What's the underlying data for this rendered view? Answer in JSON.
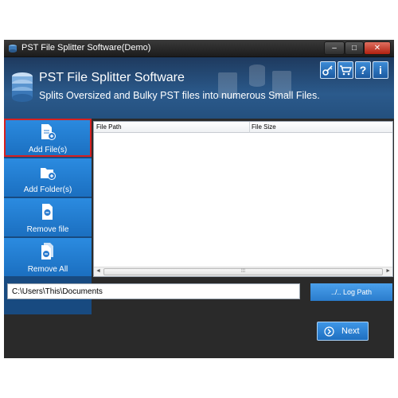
{
  "window": {
    "title": "PST File Splitter Software(Demo)"
  },
  "titlebar": {
    "minimize": "–",
    "maximize": "□",
    "close": "✕"
  },
  "header": {
    "app_name": "PST File Splitter Software",
    "tagline": "Splits Oversized and Bulky PST files into numerous Small Files.",
    "buttons": [
      {
        "icon": "key-icon",
        "symbol": "🔑"
      },
      {
        "icon": "cart-icon",
        "symbol": "🛒"
      },
      {
        "icon": "help-icon",
        "symbol": "?"
      },
      {
        "icon": "info-icon",
        "symbol": "i"
      }
    ]
  },
  "sidebar": {
    "items": [
      {
        "label": "Add File(s)",
        "icon": "add-file-icon",
        "selected": true
      },
      {
        "label": "Add Folder(s)",
        "icon": "add-folder-icon",
        "selected": false
      },
      {
        "label": "Remove file",
        "icon": "remove-file-icon",
        "selected": false
      },
      {
        "label": "Remove All",
        "icon": "remove-all-icon",
        "selected": false
      }
    ]
  },
  "table": {
    "columns": [
      "File Path",
      "File Size"
    ],
    "rows": [],
    "scroll_left": "◄",
    "scroll_right": "►",
    "scroll_grip": "⁞⁞⁞"
  },
  "log": {
    "path_value": "C:\\Users\\This\\Documents",
    "button_label": "../.. Log Path"
  },
  "footer": {
    "next_label": "Next"
  },
  "colors": {
    "accent": "#1b6fc0",
    "header": "#2b5a8c",
    "selected_outline": "#d62020"
  }
}
